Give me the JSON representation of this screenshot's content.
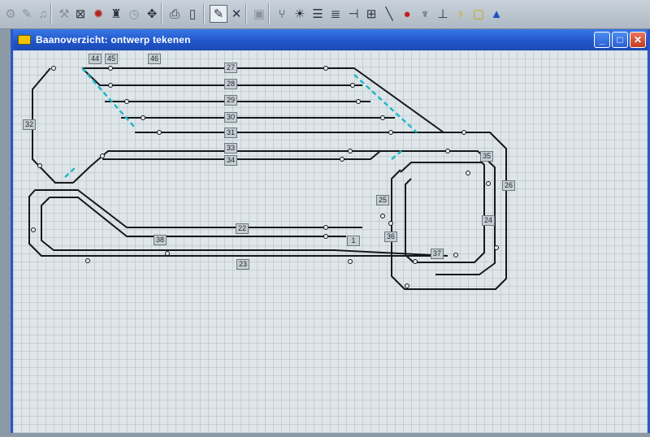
{
  "toolbar": {
    "tools": [
      "select-tool",
      "draw-tool",
      "bell-tool",
      "blocks-tool",
      "locomotive-tool",
      "train-tool",
      "clock-tool",
      "route-tool",
      "print-tool",
      "new-page-tool",
      "edit-track-tool",
      "delete-tool",
      "save-tool",
      "turnout-tool",
      "signal-tool",
      "crossing-tool",
      "sensor-tool",
      "track-element-tool",
      "diagonal-track-tool",
      "signal-red-tool",
      "signal-pole-tool",
      "buffer-stop-tool",
      "lamp-tool",
      "block-marker-tool",
      "arrow-tool"
    ]
  },
  "window": {
    "title": "Baanoverzicht: ontwerp tekenen",
    "minimize": "_",
    "maximize": "□",
    "close": "✕"
  },
  "colors": {
    "title_bar": "#2a5fd0",
    "canvas_bg": "#dfe6ea",
    "grid": "#a4adb3",
    "track": "#15181c",
    "section_divider": "#20b8c8"
  },
  "labels": {
    "l44": "44",
    "l45": "45",
    "l46": "46",
    "l27": "27",
    "l28": "28",
    "l29": "29",
    "l30": "30",
    "l31": "31",
    "l33": "33",
    "l34": "34",
    "l32": "32",
    "l35": "35",
    "l26": "26",
    "l25": "25",
    "l24": "24",
    "l22": "22",
    "l38": "38",
    "l1": "1",
    "l36": "36",
    "l37": "37",
    "l23": "23"
  }
}
